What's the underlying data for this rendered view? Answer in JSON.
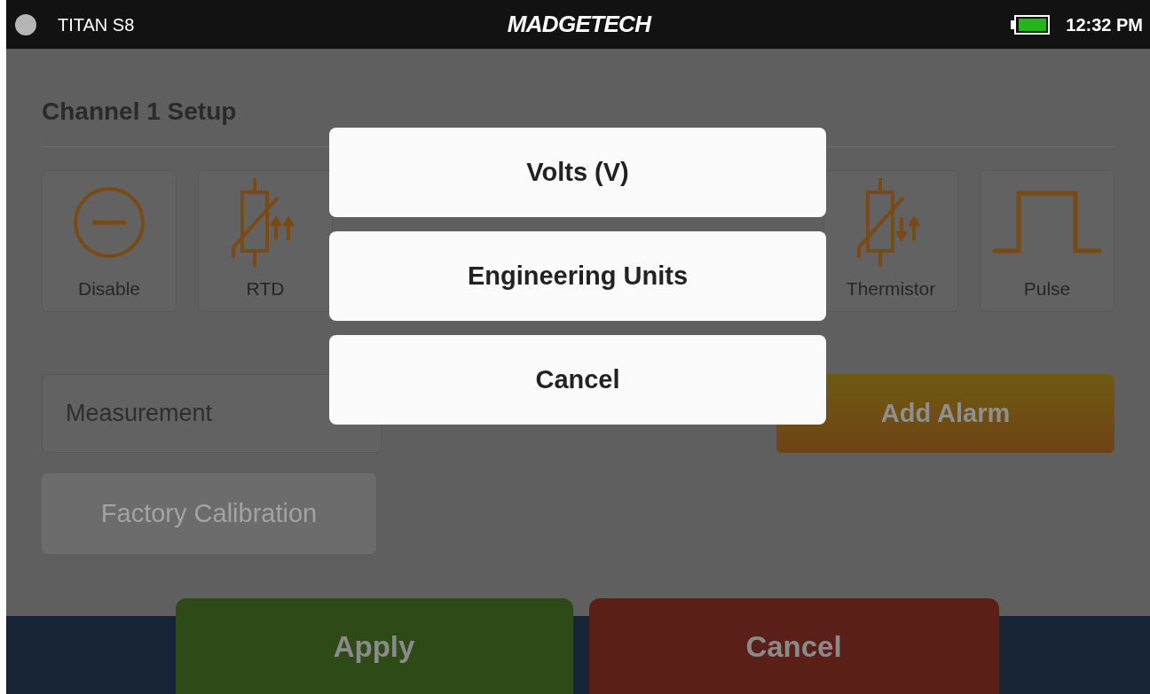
{
  "status_bar": {
    "device": "TITAN S8",
    "logo": "MADGETECH",
    "time": "12:32 PM"
  },
  "title": "Channel 1 Setup",
  "sensor_types": [
    {
      "kind": "disable",
      "label": "Disable"
    },
    {
      "kind": "rtd",
      "label": "RTD"
    },
    {
      "kind": "thermistor",
      "label": "Thermistor"
    },
    {
      "kind": "pulse",
      "label": "Pulse"
    }
  ],
  "measurement": {
    "value": "Measurement"
  },
  "add_alarm": {
    "label": "Add Alarm"
  },
  "factory_calibration": {
    "label": "Factory Calibration",
    "disabled": true
  },
  "footer": {
    "apply": "Apply",
    "cancel": "Cancel"
  },
  "popup_options": [
    "Volts (V)",
    "Engineering Units",
    "Cancel"
  ]
}
